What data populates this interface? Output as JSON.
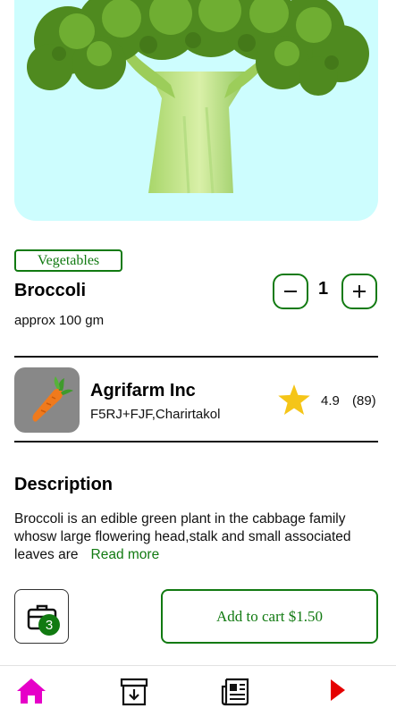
{
  "product": {
    "category": "Vegetables",
    "name": "Broccoli",
    "weight": "approx 100 gm",
    "quantity": "1",
    "hero_background": "#cdfdfe"
  },
  "seller": {
    "name": "Agrifarm Inc",
    "address": "F5RJ+FJF,Charirtakol",
    "rating": "4.9",
    "reviews": "(89)"
  },
  "description": {
    "heading": "Description",
    "text": "Broccoli is an edible green plant in the cabbage family whosw large flowering head,stalk and small associated leaves are",
    "read_more": "Read more"
  },
  "actions": {
    "bag_count": "3",
    "add_to_cart": "Add to cart $1.50"
  },
  "colors": {
    "accent": "#117a11",
    "star": "#f5c518",
    "home": "#e600c8",
    "play": "#e50000"
  },
  "nav": [
    "home-icon",
    "archive-download-icon",
    "news-icon",
    "play-icon"
  ]
}
